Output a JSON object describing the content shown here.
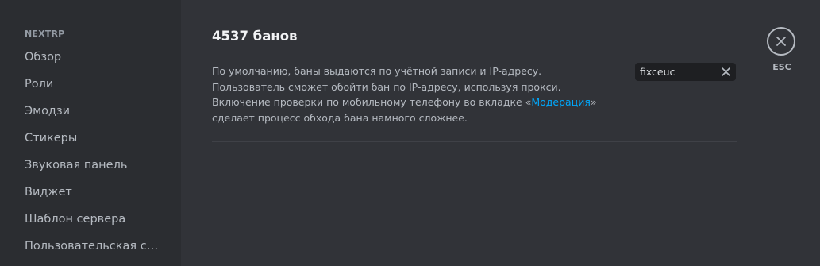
{
  "sidebar": {
    "header": "NEXTRP",
    "items": [
      {
        "label": "Обзор"
      },
      {
        "label": "Роли"
      },
      {
        "label": "Эмодзи"
      },
      {
        "label": "Стикеры"
      },
      {
        "label": "Звуковая панель"
      },
      {
        "label": "Виджет"
      },
      {
        "label": "Шаблон сервера"
      },
      {
        "label": "Пользовательская ссылка"
      }
    ]
  },
  "main": {
    "title": "4537 банов",
    "description": {
      "before_link": "По умолчанию, баны выдаются по учётной записи и IP-адресу. Пользователь сможет обойти бан по IP-адресу, используя прокси. Включение проверки по мобильному телефону во вкладке «",
      "link": "Модерация",
      "after_link": "» сделает процесс обхода бана намного сложнее."
    },
    "search": {
      "value": "fixceuc",
      "placeholder": ""
    }
  },
  "close": {
    "esc_label": "ESC"
  },
  "icons": {
    "clear": "close-icon",
    "close": "close-circle-icon"
  },
  "colors": {
    "background": "#313338",
    "sidebar": "#2b2d31",
    "link": "#00a8fc",
    "text_muted": "#b5bac1",
    "heading": "#f2f3f5"
  }
}
